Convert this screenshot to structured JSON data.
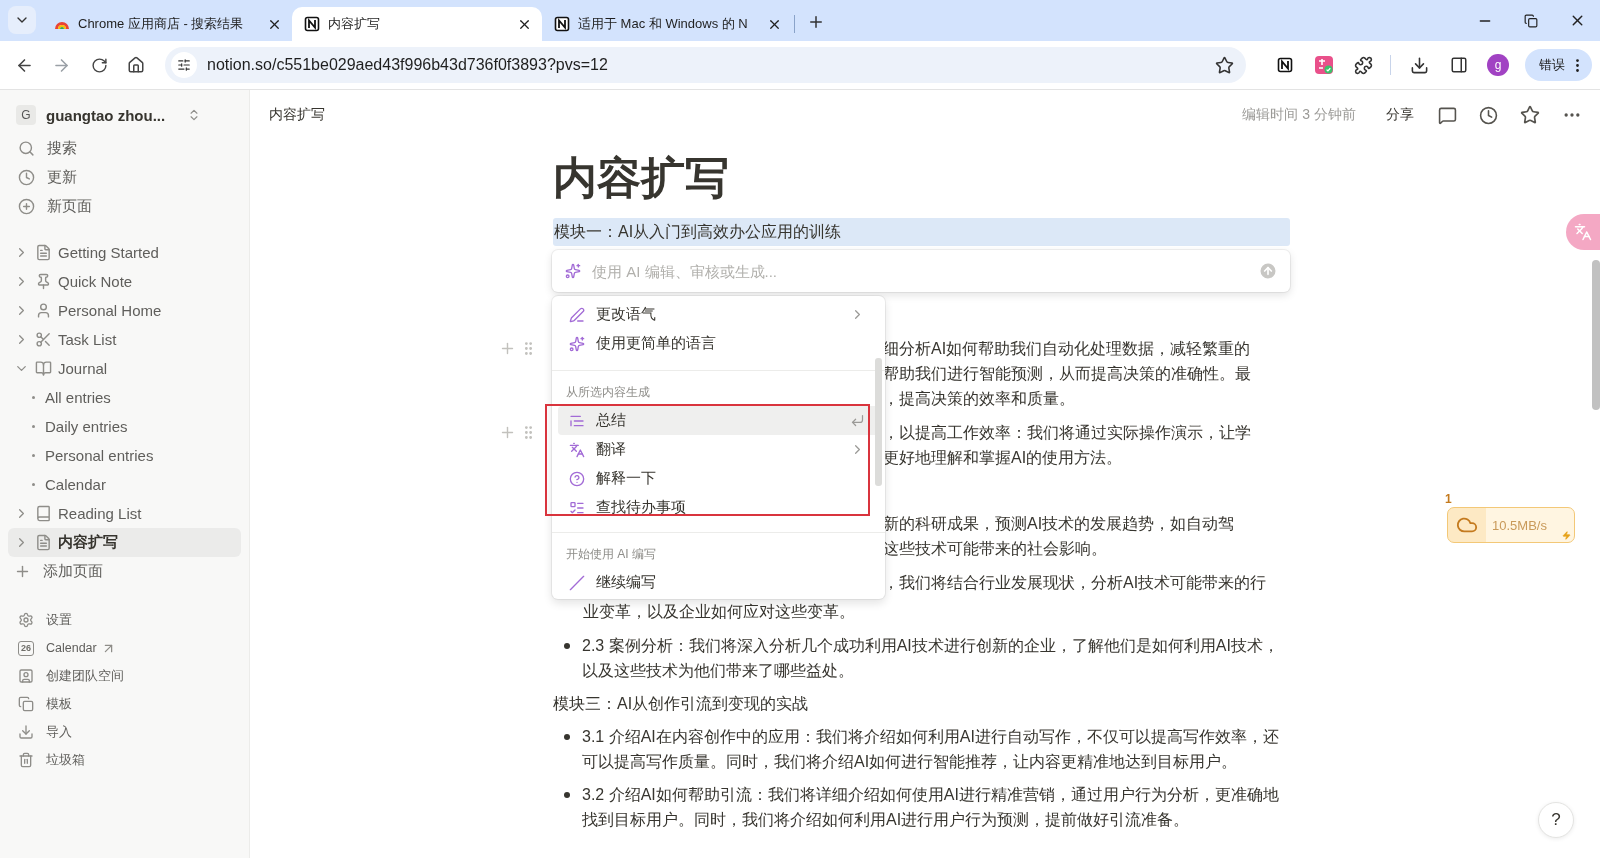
{
  "browser": {
    "tabs": [
      {
        "title": "Chrome 应用商店 - 搜索结果",
        "selected": false
      },
      {
        "title": "内容扩写",
        "selected": true
      },
      {
        "title": "适用于 Mac 和 Windows 的 N",
        "selected": false
      }
    ],
    "url": "notion.so/c551be029aed43f996b43d736f0f3893?pvs=12",
    "profile_initial": "g",
    "status_chip": "错误"
  },
  "sidebar": {
    "workspace": {
      "initial": "G",
      "name": "guangtao zhou..."
    },
    "actions": [
      {
        "label": "搜索"
      },
      {
        "label": "更新"
      },
      {
        "label": "新页面"
      }
    ],
    "pages": [
      {
        "label": "Getting Started",
        "expanded": false,
        "selected": false
      },
      {
        "label": "Quick Note",
        "expanded": false,
        "selected": false
      },
      {
        "label": "Personal Home",
        "expanded": false,
        "selected": false
      },
      {
        "label": "Task List",
        "expanded": false,
        "selected": false
      },
      {
        "label": "Journal",
        "expanded": true,
        "selected": false,
        "children": [
          {
            "label": "All entries"
          },
          {
            "label": "Daily entries"
          },
          {
            "label": "Personal entries"
          },
          {
            "label": "Calendar"
          }
        ]
      },
      {
        "label": "Reading List",
        "expanded": false,
        "selected": false
      },
      {
        "label": "内容扩写",
        "expanded": false,
        "selected": true
      }
    ],
    "add_page": "添加页面",
    "footer": [
      {
        "label": "设置",
        "external": false
      },
      {
        "label": "Calendar",
        "external": true,
        "date": "26"
      },
      {
        "label": "创建团队空间",
        "external": false
      },
      {
        "label": "模板",
        "external": false
      },
      {
        "label": "导入",
        "external": false
      },
      {
        "label": "垃圾箱",
        "external": false
      }
    ]
  },
  "header": {
    "breadcrumb": "内容扩写",
    "edited": "编辑时间 3 分钟前",
    "share": "分享"
  },
  "document": {
    "title": "内容扩写",
    "heading": "模块一：AI从入门到高效办公应用的训练",
    "heading_selected": true,
    "blocks": [
      {
        "kind": "fragment",
        "handle": true,
        "lines": [
          "细分析AI如何帮助我们自动化处理数据，减轻繁重的",
          "帮助我们进行智能预测，从而提高决策的准确性。最",
          "，提高决策的效率和质量。"
        ]
      },
      {
        "kind": "fragment",
        "handle": true,
        "lines": [
          "，以提高工作效率：我们将通过实际操作演示，让学",
          "更好地理解和掌握AI的使用方法。"
        ]
      },
      {
        "kind": "fragment",
        "handle": false,
        "lines": [
          "新的科研成果，预测AI技术的发展趋势，如自动驾",
          "这些技术可能带来的社会影响。"
        ]
      },
      {
        "kind": "bullet_tail",
        "handle": false,
        "lines": [
          "，我们将结合行业发展现状，分析AI技术可能带来的行"
        ],
        "text": "业变革，以及企业如何应对这些变革。"
      },
      {
        "kind": "bullet",
        "handle": false,
        "text": "2.3 案例分析：我们将深入分析几个成功利用AI技术进行创新的企业，了解他们是如何利用AI技术，以及这些技术为他们带来了哪些益处。"
      },
      {
        "kind": "heading",
        "handle": false,
        "text": "模块三：AI从创作引流到变现的实战"
      },
      {
        "kind": "bullet",
        "handle": false,
        "text": "3.1 介绍AI在内容创作中的应用：我们将介绍如何利用AI进行自动写作，不仅可以提高写作效率，还可以提高写作质量。同时，我们将介绍AI如何进行智能推荐，让内容更精准地达到目标用户。"
      },
      {
        "kind": "bullet",
        "handle": false,
        "text": "3.2 介绍AI如何帮助引流：我们将详细介绍如何使用AI进行精准营销，通过用户行为分析，更准确地找到目标用户。同时，我们将介绍如何利用AI进行用户行为预测，提前做好引流准备。"
      }
    ]
  },
  "ai_prompt": {
    "placeholder": "使用 AI 编辑、审核或生成..."
  },
  "ai_menu": {
    "sections": [
      {
        "items": [
          {
            "label": "更改语气",
            "selected": false,
            "submenu": true
          },
          {
            "label": "使用更简单的语言",
            "selected": false,
            "submenu": false
          }
        ]
      },
      {
        "label": "从所选内容生成",
        "items": [
          {
            "label": "总结",
            "selected": true,
            "submenu": false
          },
          {
            "label": "翻译",
            "selected": false,
            "submenu": true
          },
          {
            "label": "解释一下",
            "selected": false,
            "submenu": false
          },
          {
            "label": "查找待办事项",
            "selected": false,
            "submenu": false
          }
        ]
      },
      {
        "label": "开始使用 AI 编写",
        "items": [
          {
            "label": "继续编写",
            "selected": false,
            "submenu": false
          }
        ]
      }
    ]
  },
  "download_badge": {
    "count": "1",
    "speed": "10.5MB/s"
  },
  "help": "?"
}
